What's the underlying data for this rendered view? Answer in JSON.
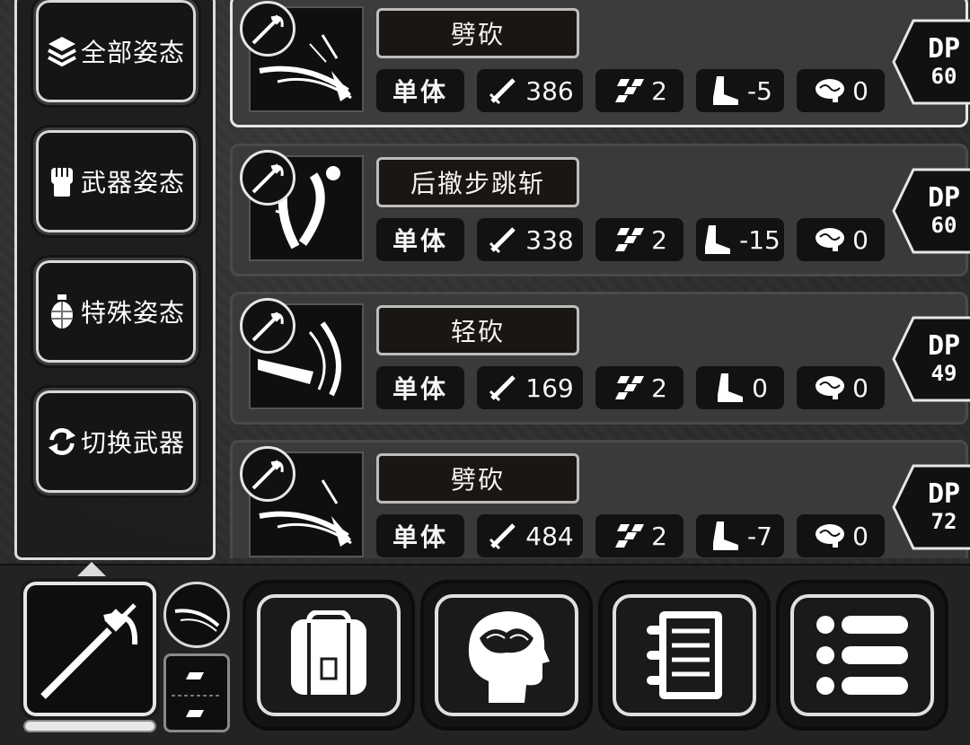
{
  "stance_menu": {
    "items": [
      {
        "label": "全部姿态",
        "icon": "layers-icon"
      },
      {
        "label": "武器姿态",
        "icon": "fist-icon"
      },
      {
        "label": "特殊姿态",
        "icon": "grenade-icon"
      },
      {
        "label": "切换武器",
        "icon": "swap-arrows-icon"
      }
    ]
  },
  "skills": [
    {
      "name": "劈砍",
      "target": "单体",
      "attack": "386",
      "hits": "2",
      "move": "-5",
      "mind": "0",
      "dp_label": "DP",
      "dp_value": "60",
      "selected": true,
      "art": "slash-art"
    },
    {
      "name": "后撤步跳斩",
      "target": "单体",
      "attack": "338",
      "hits": "2",
      "move": "-15",
      "mind": "0",
      "dp_label": "DP",
      "dp_value": "60",
      "selected": false,
      "art": "backstep-art"
    },
    {
      "name": "轻砍",
      "target": "单体",
      "attack": "169",
      "hits": "2",
      "move": "0",
      "mind": "0",
      "dp_label": "DP",
      "dp_value": "49",
      "selected": false,
      "art": "light-slash-art"
    },
    {
      "name": "劈砍",
      "target": "单体",
      "attack": "484",
      "hits": "2",
      "move": "-7",
      "mind": "0",
      "dp_label": "DP",
      "dp_value": "72",
      "selected": false,
      "art": "slash-art"
    }
  ],
  "bottom_bar": {
    "weapon_icon": "saber-icon",
    "weapon_gauge_fraction": 1.0,
    "menu_buttons": [
      {
        "icon": "backpack-icon"
      },
      {
        "icon": "brain-head-icon"
      },
      {
        "icon": "notebook-icon"
      },
      {
        "icon": "list-menu-icon"
      }
    ]
  },
  "colors": {
    "card_bg": "#3a3a3a",
    "card_selected_border": "#e8e8e8",
    "stat_bg": "#121212",
    "name_bg": "#1a1613"
  }
}
